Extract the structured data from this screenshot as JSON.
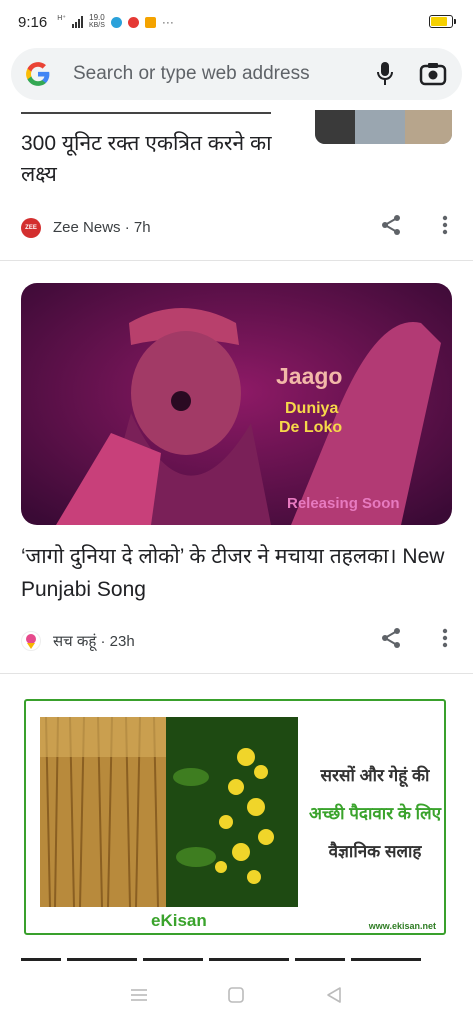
{
  "status_bar": {
    "time": "9:16",
    "network_type": "H⁺",
    "net_speed_value": "19.0",
    "net_speed_unit": "KB/S",
    "more": "···",
    "battery_level": 0.8
  },
  "omnibox": {
    "placeholder": "Search or type web address"
  },
  "cards": [
    {
      "title": "300 यूनिट रक्त एकत्रित करने का लक्ष्य",
      "source": "Zee News · 7h",
      "source_logo": "ZEE"
    },
    {
      "image": {
        "title": "Jaago",
        "line1": "Duniya",
        "line2": "De Loko",
        "tagline": "Releasing Soon"
      },
      "title": "‘जागो दुनिया दे लोको’ के टीजर ने मचाया तहलका। New Punjabi Song",
      "source": "सच कहूं · 23h"
    }
  ],
  "ad": {
    "line1": "सरसों और गेहूं की",
    "line2": "अच्छी पैदावार के लिए",
    "line3": "वैज्ञानिक सलाह",
    "brand": "eKisan",
    "url": "www.ekisan.net"
  },
  "colors": {
    "accent_green": "#3aa32c",
    "hero_bg": "#6b1150",
    "hero_title": "#f2b8a8",
    "hero_sub": "#f6d84a",
    "hero_tag": "#e77ac0"
  },
  "icons": {
    "share": "share-icon",
    "more": "more-vertical-icon",
    "mic": "mic-icon",
    "lens": "camera-icon"
  }
}
